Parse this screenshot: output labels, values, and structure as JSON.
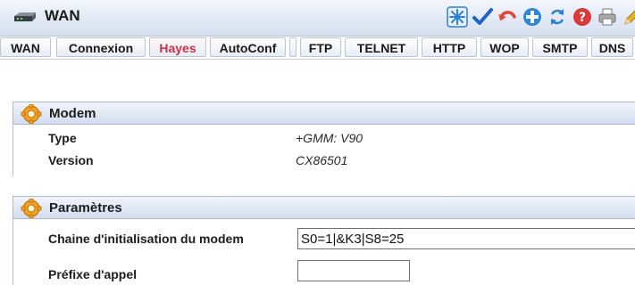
{
  "window": {
    "title": "WAN",
    "icon": "modem-icon"
  },
  "toolbar": {
    "buttons": [
      {
        "name": "snowflake-icon",
        "color": "#2a7fd6"
      },
      {
        "name": "checkmark-icon",
        "color": "#1f62c9"
      },
      {
        "name": "undo-icon",
        "color": "#e0473a"
      },
      {
        "name": "plus-circle-icon",
        "color": "#2d86d8"
      },
      {
        "name": "refresh-icon",
        "color": "#2a7fd6"
      },
      {
        "name": "help-icon",
        "color": "#d83a3a"
      },
      {
        "name": "print-icon",
        "color": "#7a7a7a"
      },
      {
        "name": "pencil-icon",
        "color": "#e6b324"
      }
    ]
  },
  "tabs": [
    {
      "label": "WAN",
      "active": false
    },
    {
      "label": "Connexion",
      "active": false
    },
    {
      "label": "Hayes",
      "active": true
    },
    {
      "label": "AutoConf",
      "active": false
    },
    {
      "label": "",
      "active": false
    },
    {
      "label": "FTP",
      "active": false
    },
    {
      "label": "TELNET",
      "active": false
    },
    {
      "label": "HTTP",
      "active": false
    },
    {
      "label": "WOP",
      "active": false
    },
    {
      "label": "SMTP",
      "active": false
    },
    {
      "label": "DNS",
      "active": false
    }
  ],
  "modem": {
    "header": "Modem",
    "rows": [
      {
        "label": "Type",
        "value": "+GMM: V90"
      },
      {
        "label": "Version",
        "value": "CX86501"
      }
    ]
  },
  "parametres": {
    "header": "Paramètres",
    "init_string": {
      "label": "Chaine d'initialisation du modem",
      "value": "S0=1|&K3|S8=25"
    },
    "dial_prefix": {
      "label": "Préfixe d'appel",
      "value": ""
    }
  },
  "colors": {
    "active_tab": "#c8314a",
    "header_gradient_top": "#f1f5fb",
    "header_gradient_bottom": "#d3ddee"
  }
}
